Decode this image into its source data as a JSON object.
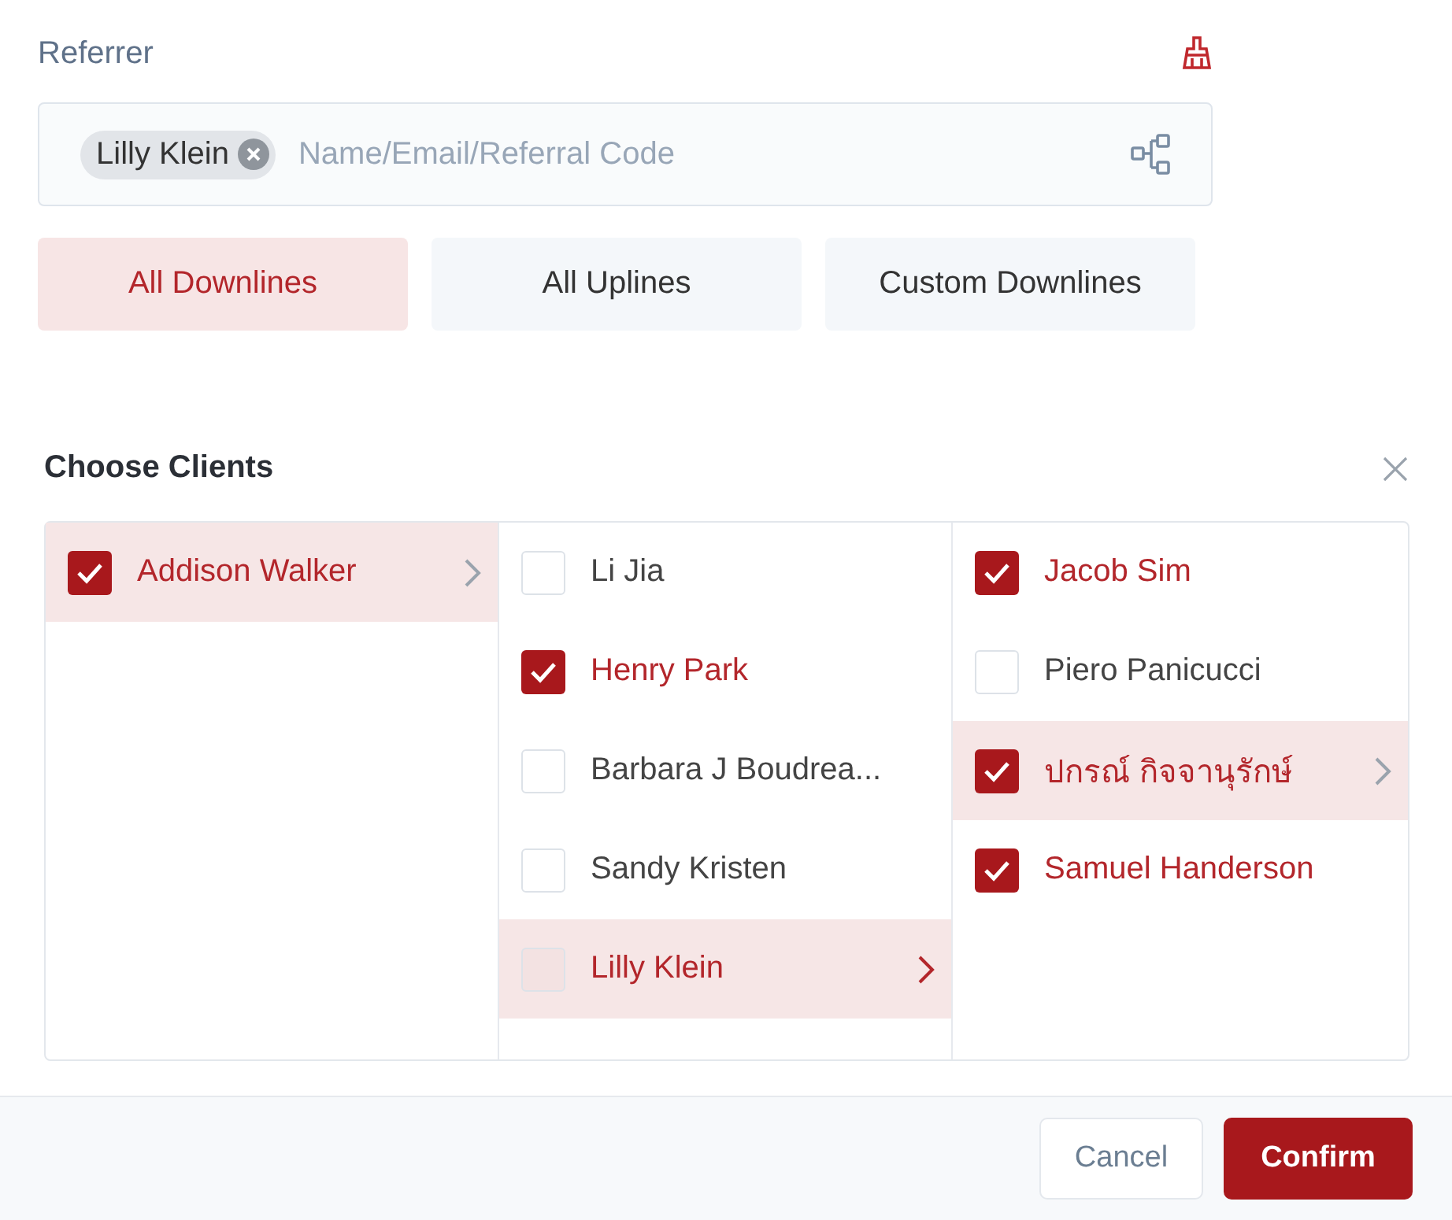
{
  "referrer": {
    "label": "Referrer",
    "chip": "Lilly Klein",
    "placeholder": "Name/Email/Referral Code"
  },
  "tabs": [
    {
      "label": "All Downlines",
      "selected": true
    },
    {
      "label": "All Uplines",
      "selected": false
    },
    {
      "label": "Custom Downlines",
      "selected": false
    }
  ],
  "clients": {
    "title": "Choose Clients",
    "columns": [
      [
        {
          "name": "Addison Walker",
          "checked": true,
          "selected": true,
          "expandable": true,
          "disabled": false
        }
      ],
      [
        {
          "name": "Li Jia",
          "checked": false,
          "selected": false,
          "expandable": false,
          "disabled": false
        },
        {
          "name": "Henry Park",
          "checked": true,
          "selected": false,
          "expandable": false,
          "disabled": false
        },
        {
          "name": "Barbara J Boudrea...",
          "checked": false,
          "selected": false,
          "expandable": false,
          "disabled": false
        },
        {
          "name": "Sandy Kristen",
          "checked": false,
          "selected": false,
          "expandable": false,
          "disabled": false
        },
        {
          "name": "Lilly Klein",
          "checked": false,
          "selected": true,
          "expandable": true,
          "disabled": true
        }
      ],
      [
        {
          "name": "Jacob Sim",
          "checked": true,
          "selected": false,
          "expandable": false,
          "disabled": false
        },
        {
          "name": "Piero Panicucci",
          "checked": false,
          "selected": false,
          "expandable": false,
          "disabled": false
        },
        {
          "name": "ปกรณ์ กิจจานุรักษ์",
          "checked": true,
          "selected": true,
          "expandable": true,
          "disabled": false
        },
        {
          "name": "Samuel Handerson",
          "checked": true,
          "selected": false,
          "expandable": false,
          "disabled": false
        }
      ]
    ]
  },
  "buttons": {
    "cancel": "Cancel",
    "confirm": "Confirm"
  }
}
